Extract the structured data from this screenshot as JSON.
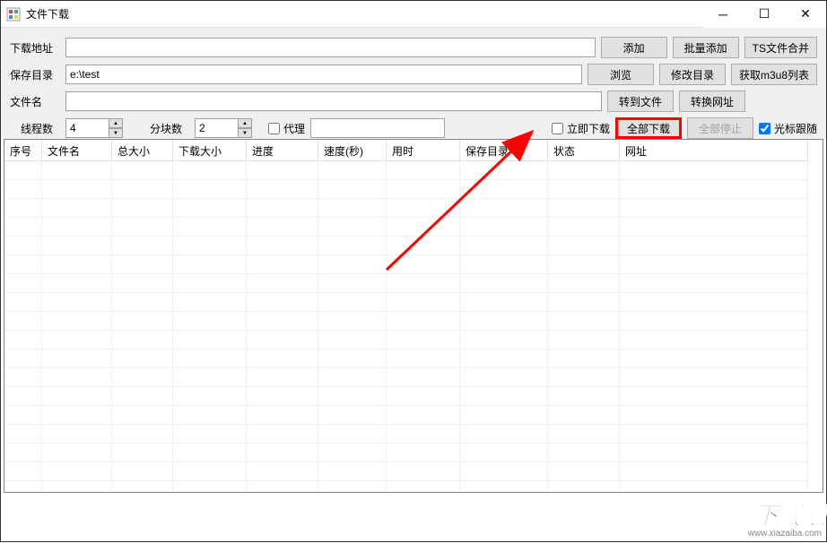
{
  "window": {
    "title": "文件下载"
  },
  "labels": {
    "download_url": "下载地址",
    "save_dir": "保存目录",
    "filename": "文件名",
    "threads": "线程数",
    "chunks": "分块数"
  },
  "inputs": {
    "download_url": "",
    "save_dir": "e:\\test",
    "filename": "",
    "threads": "4",
    "chunks": "2",
    "proxy": ""
  },
  "buttons": {
    "add": "添加",
    "batch_add": "批量添加",
    "ts_merge": "TS文件合并",
    "browse": "浏览",
    "modify_dir": "修改目录",
    "get_m3u8": "获取m3u8列表",
    "to_file": "转到文件",
    "convert_url": "转换网址",
    "download_all": "全部下载",
    "stop_all": "全部停止"
  },
  "checkboxes": {
    "proxy": "代理",
    "instant_download": "立即下载",
    "cursor_follow": "光标跟随"
  },
  "columns": {
    "seq": "序号",
    "filename": "文件名",
    "total_size": "总大小",
    "dl_size": "下载大小",
    "progress": "进度",
    "speed": "速度(秒)",
    "elapsed": "用时",
    "save_dir": "保存目录",
    "status": "状态",
    "url": "网址"
  },
  "watermark": {
    "logo": "下载吧",
    "url": "www.xiazaiba.com"
  }
}
